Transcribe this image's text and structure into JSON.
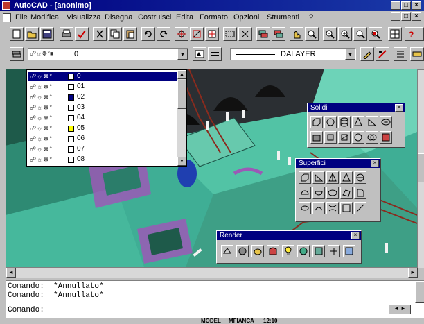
{
  "window": {
    "title": "AutoCAD - [anonimo]"
  },
  "menu": [
    "File",
    "Modifica",
    "Visualizza",
    "Disegna",
    "Costruisci",
    "Edita",
    "Formato",
    "Opzioni",
    "Strumenti",
    "?"
  ],
  "layer_combo": {
    "value": "0"
  },
  "linetype_combo": {
    "value": "DALAYER"
  },
  "layers": [
    {
      "name": "0",
      "color": "#ffffff",
      "selected": true
    },
    {
      "name": "01",
      "color": "#ffffff"
    },
    {
      "name": "02",
      "color": "#000080"
    },
    {
      "name": "03",
      "color": "#ffffff"
    },
    {
      "name": "04",
      "color": "#ffffff"
    },
    {
      "name": "05",
      "color": "#ffff00"
    },
    {
      "name": "06",
      "color": "#ffffff"
    },
    {
      "name": "07",
      "color": "#ffffff"
    },
    {
      "name": "08",
      "color": "#ffffff"
    }
  ],
  "palettes": {
    "solidi": {
      "title": "Solidi"
    },
    "superfici": {
      "title": "Superfici"
    },
    "render": {
      "title": "Render"
    }
  },
  "command": {
    "lines": [
      "Comando:  *Annullato*",
      "Comando:  *Annullato*",
      "Comando:"
    ]
  },
  "status": {
    "model": "MODEL",
    "mfianca": "MFIANCA",
    "time": "12:10"
  }
}
